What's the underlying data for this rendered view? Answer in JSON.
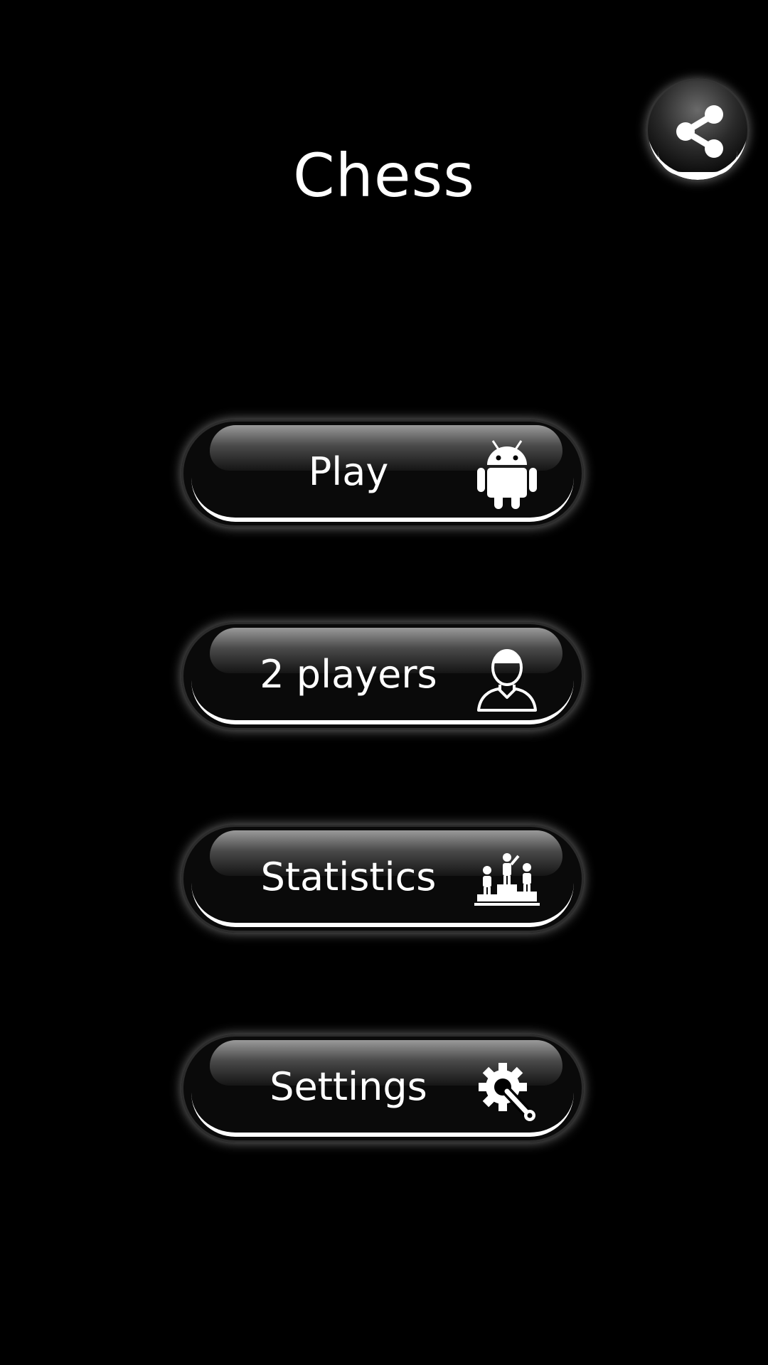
{
  "app": {
    "title": "Chess"
  },
  "header": {
    "share_icon": "share-icon"
  },
  "menu": {
    "items": [
      {
        "label": "Play",
        "icon": "android-robot-icon"
      },
      {
        "label": "2 players",
        "icon": "person-icon"
      },
      {
        "label": "Statistics",
        "icon": "podium-icon"
      },
      {
        "label": "Settings",
        "icon": "gear-wrench-icon"
      }
    ]
  },
  "colors": {
    "background": "#000000",
    "text": "#ffffff",
    "button_body": "#0a0a0a",
    "button_glow": "#ffffff"
  }
}
